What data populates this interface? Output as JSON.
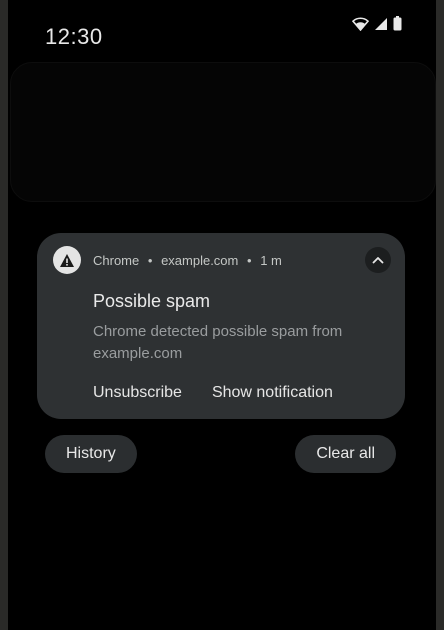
{
  "status_bar": {
    "time": "12:30",
    "icons": [
      "wifi-icon",
      "cell-signal-icon",
      "battery-icon"
    ]
  },
  "notification": {
    "app_icon": "warning-icon",
    "app_name": "Chrome",
    "separator": "•",
    "source": "example.com",
    "age": "1 m",
    "expand_icon": "chevron-up-icon",
    "title": "Possible spam",
    "body": "Chrome detected possible spam from example.com",
    "actions": [
      "Unsubscribe",
      "Show notification"
    ]
  },
  "footer": {
    "history_label": "History",
    "clear_all_label": "Clear all"
  },
  "colors": {
    "background": "#000000",
    "card": "#2e3133",
    "pill": "#2b2e30",
    "primary_text": "#eaeaea",
    "secondary_text": "#9a9d9f"
  }
}
